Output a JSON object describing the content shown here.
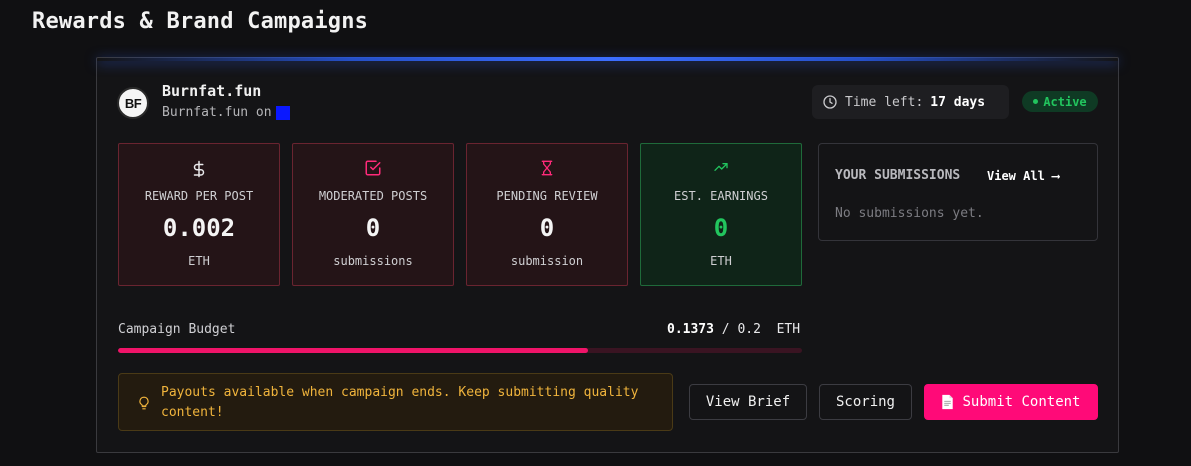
{
  "page": {
    "title": "Rewards & Brand Campaigns"
  },
  "campaign": {
    "logo_text": "BF",
    "name": "Burnfat.fun",
    "subtitle": "Burnfat.fun on",
    "time_left_label": "Time left:",
    "time_left_value": "17 days",
    "status": "Active"
  },
  "stats": [
    {
      "icon": "dollar-icon",
      "label": "REWARD PER POST",
      "value": "0.002",
      "unit": "ETH"
    },
    {
      "icon": "check-square-icon",
      "label": "MODERATED POSTS",
      "value": "0",
      "unit": "submissions"
    },
    {
      "icon": "hourglass-icon",
      "label": "PENDING REVIEW",
      "value": "0",
      "unit": "submission"
    },
    {
      "icon": "trending-up-icon",
      "label": "EST. EARNINGS",
      "value": "0",
      "unit": "ETH"
    }
  ],
  "submissions": {
    "title": "YOUR SUBMISSIONS",
    "view_all": "View All ⟶",
    "empty": "No submissions yet."
  },
  "budget": {
    "label": "Campaign Budget",
    "spent": "0.1373",
    "separator": "/",
    "total": "0.2",
    "currency": "ETH",
    "fill_fraction": 0.6865
  },
  "notice": {
    "text": "Payouts available when campaign ends. Keep submitting quality content!"
  },
  "actions": {
    "view_brief": "View Brief",
    "scoring": "Scoring",
    "submit": "Submit Content"
  },
  "colors": {
    "accent": "#ff0a78",
    "success": "#22c55e",
    "warning": "#f0b43c",
    "platform": "#0a18ff"
  }
}
